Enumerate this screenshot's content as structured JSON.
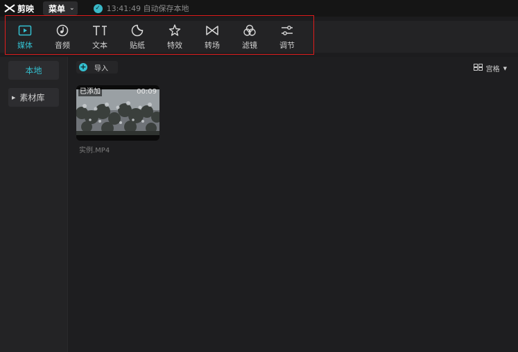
{
  "titlebar": {
    "app_name": "剪映",
    "menu_label": "菜单",
    "autosave_text": "13:41:49 自动保存本地"
  },
  "toolbar": {
    "items": [
      {
        "label": "媒体",
        "icon": "media-icon",
        "active": true
      },
      {
        "label": "音频",
        "icon": "audio-icon"
      },
      {
        "label": "文本",
        "icon": "text-icon"
      },
      {
        "label": "贴纸",
        "icon": "sticker-icon"
      },
      {
        "label": "特效",
        "icon": "effects-icon"
      },
      {
        "label": "转场",
        "icon": "transition-icon"
      },
      {
        "label": "滤镜",
        "icon": "filter-icon"
      },
      {
        "label": "调节",
        "icon": "adjust-icon"
      }
    ],
    "accent_color": "#34c0d0",
    "highlight_border": "#e01c1c"
  },
  "sidebar": {
    "local": "本地",
    "library": "素材库"
  },
  "main": {
    "import_label": "导入",
    "view_label": "宫格",
    "media": [
      {
        "badge": "已添加",
        "duration": "00:09",
        "filename": "实例.MP4"
      }
    ]
  }
}
